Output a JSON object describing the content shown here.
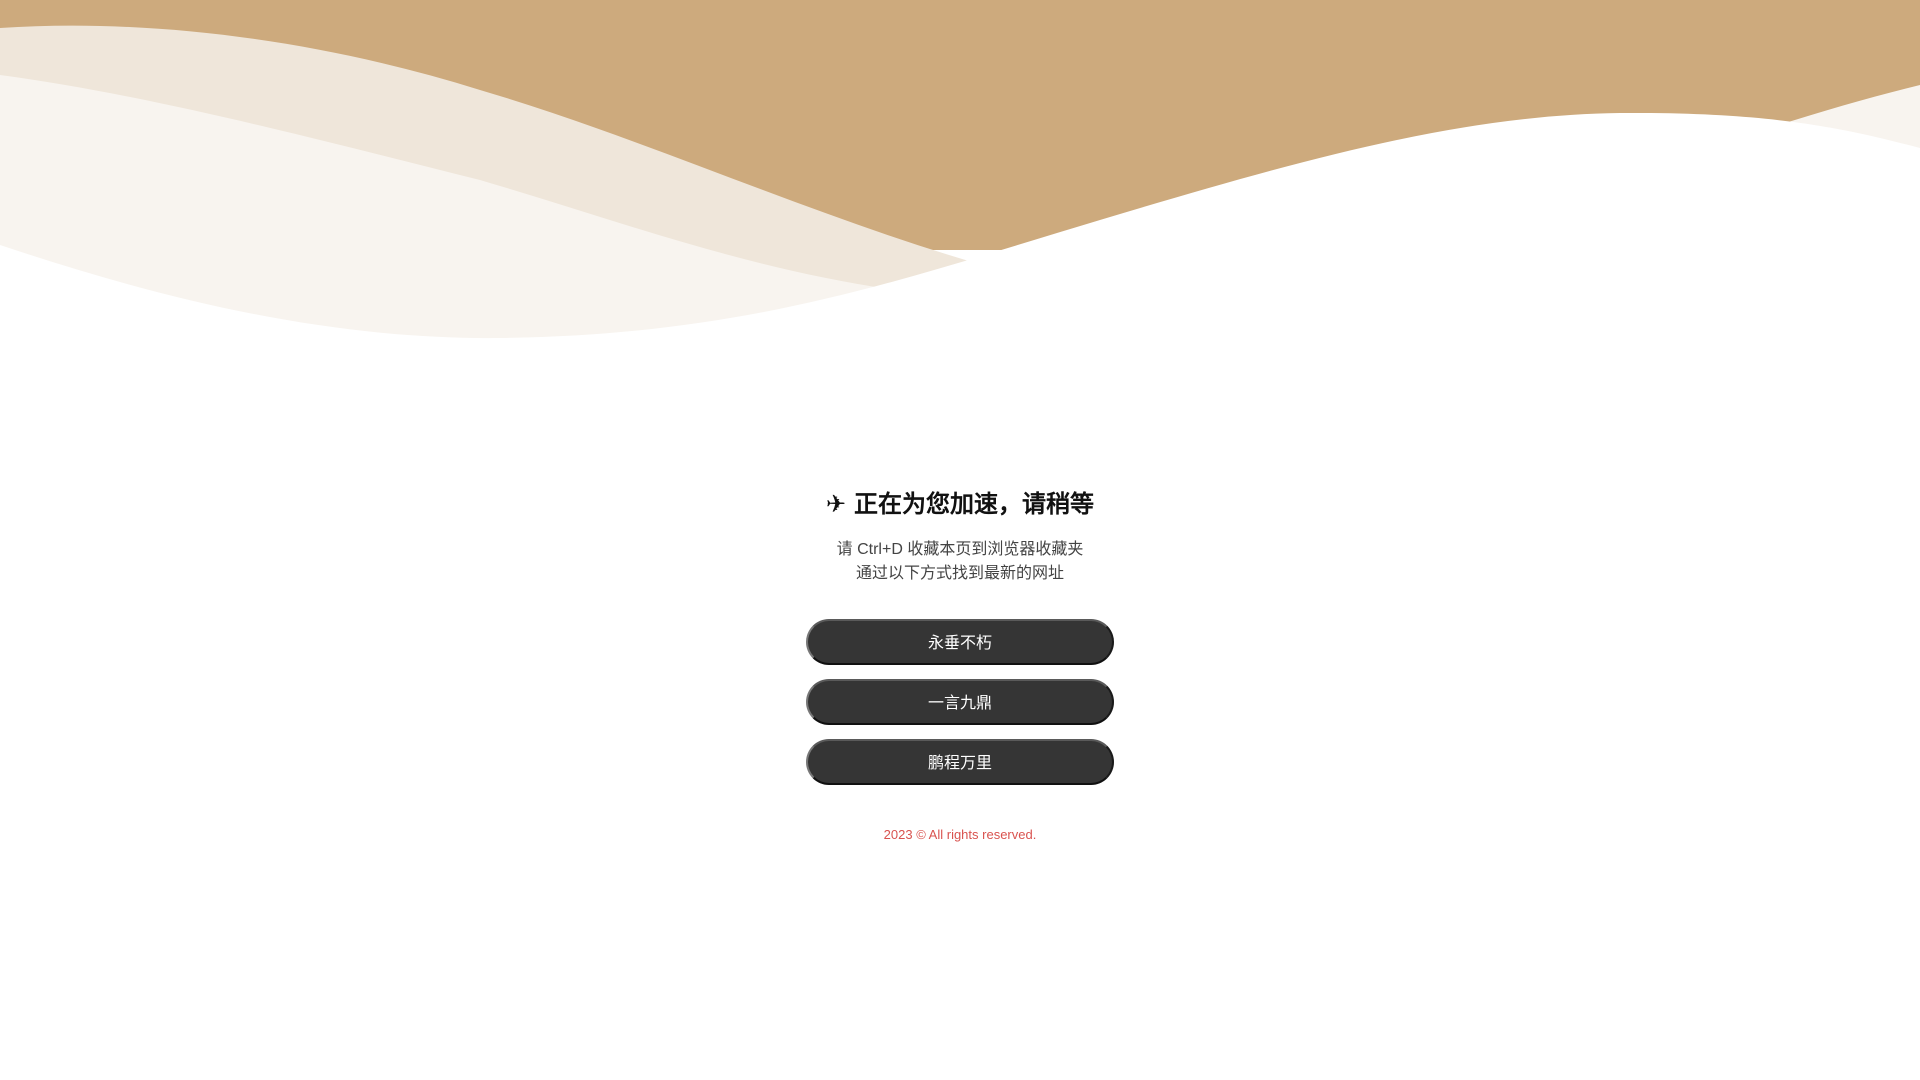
{
  "header": {
    "plane_icon": "✈",
    "title": "正在为您加速，请稍等"
  },
  "notice": {
    "line1": "请 Ctrl+D 收藏本页到浏览器收藏夹",
    "line2": "通过以下方式找到最新的网址"
  },
  "links": [
    {
      "label": "永垂不朽"
    },
    {
      "label": "一言九鼎"
    },
    {
      "label": "鹏程万里"
    }
  ],
  "footer": {
    "copyright": "2023 © All rights reserved."
  },
  "colors": {
    "wave_primary": "#cdaa7d",
    "wave_light": "#efe6da",
    "wave_lighter": "#f8f4ef",
    "button_bg": "#353535",
    "footer_text": "#d9534f"
  }
}
